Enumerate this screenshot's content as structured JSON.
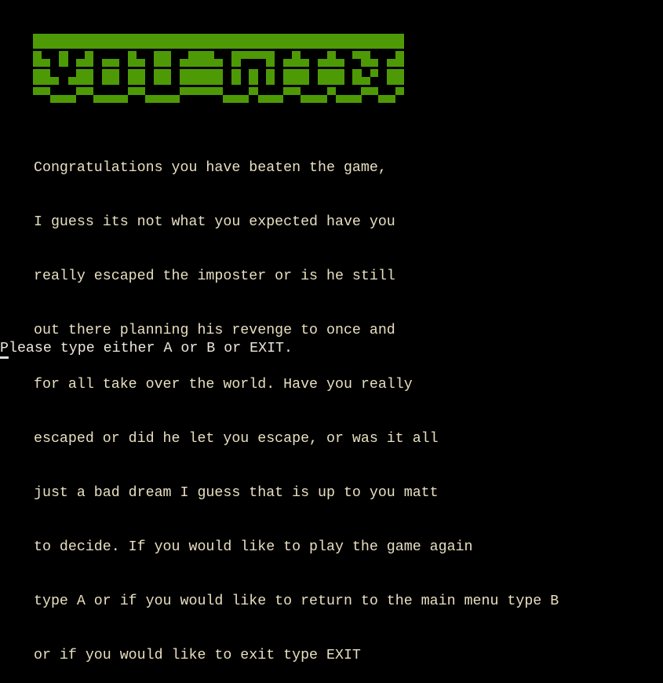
{
  "banner": {
    "color": "#4e9a06",
    "label": "YOU WON"
  },
  "story_lines": [
    "Congratulations you have beaten the game,",
    "I guess its not what you expected have you",
    "really escaped the imposter or is he still",
    "out there planning his revenge to once and",
    "for all take over the world. Have you really",
    "escaped or did he let you escape, or was it all",
    "just a bad dream I guess that is up to you matt",
    "to decide. If you would like to play the game again",
    "type A or if you would like to return to the main menu type B",
    "or if you would like to exit type EXIT"
  ],
  "prompt": "Please type either A or B or EXIT."
}
